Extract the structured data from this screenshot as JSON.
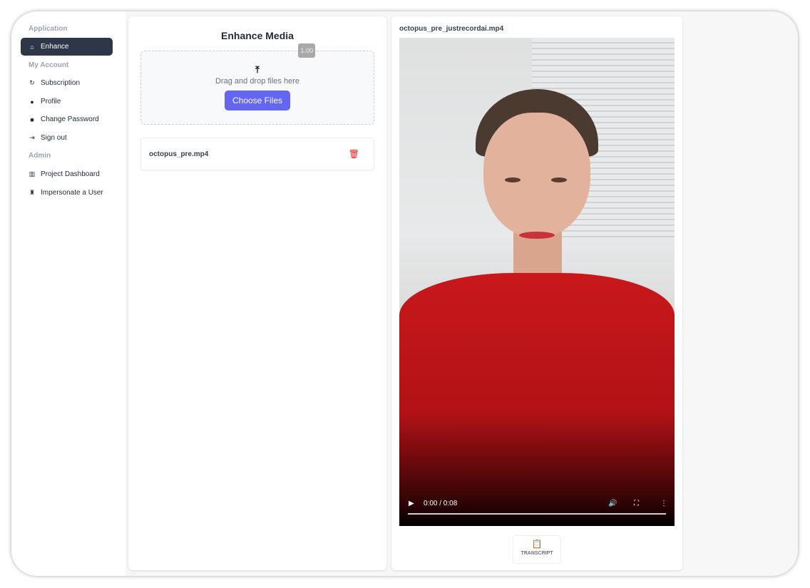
{
  "sidebar": {
    "sections": [
      {
        "label": "Application",
        "items": [
          {
            "label": "Enhance",
            "icon": "home-icon",
            "active": true
          }
        ]
      },
      {
        "label": "My Account",
        "items": [
          {
            "label": "Subscription",
            "icon": "refresh-icon"
          },
          {
            "label": "Profile",
            "icon": "user-icon"
          },
          {
            "label": "Change Password",
            "icon": "lock-open-icon"
          },
          {
            "label": "Sign out",
            "icon": "sign-out-icon"
          }
        ]
      },
      {
        "label": "Admin",
        "items": [
          {
            "label": "Project Dashboard",
            "icon": "chart-icon"
          },
          {
            "label": "Impersonate a User",
            "icon": "user-secret-icon"
          }
        ]
      }
    ]
  },
  "enhance": {
    "title": "Enhance Media",
    "badge": "1.00",
    "drop_text": "Drag and drop files here",
    "choose_label": "Choose Files",
    "files": [
      {
        "name": "octopus_pre.mp4"
      }
    ]
  },
  "preview": {
    "filename": "octopus_pre_justrecordai.mp4",
    "time": "0:00 / 0:08",
    "progress": 0,
    "transcript_label": "TRANSCRIPT"
  },
  "colors": {
    "accent": "#6366f1",
    "active_nav": "#2d3748",
    "delete": "#ef1c1c"
  }
}
